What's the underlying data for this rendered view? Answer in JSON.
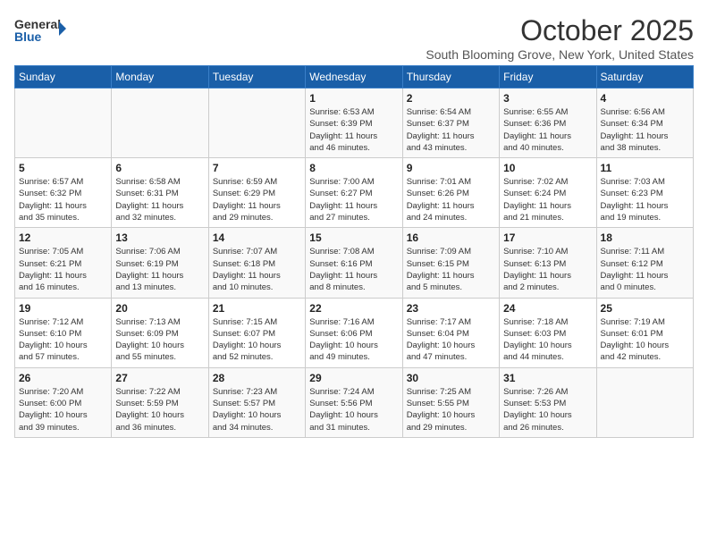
{
  "logo": {
    "line1": "General",
    "line2": "Blue"
  },
  "title": "October 2025",
  "subtitle": "South Blooming Grove, New York, United States",
  "days_of_week": [
    "Sunday",
    "Monday",
    "Tuesday",
    "Wednesday",
    "Thursday",
    "Friday",
    "Saturday"
  ],
  "weeks": [
    [
      {
        "day": "",
        "info": ""
      },
      {
        "day": "",
        "info": ""
      },
      {
        "day": "",
        "info": ""
      },
      {
        "day": "1",
        "info": "Sunrise: 6:53 AM\nSunset: 6:39 PM\nDaylight: 11 hours\nand 46 minutes."
      },
      {
        "day": "2",
        "info": "Sunrise: 6:54 AM\nSunset: 6:37 PM\nDaylight: 11 hours\nand 43 minutes."
      },
      {
        "day": "3",
        "info": "Sunrise: 6:55 AM\nSunset: 6:36 PM\nDaylight: 11 hours\nand 40 minutes."
      },
      {
        "day": "4",
        "info": "Sunrise: 6:56 AM\nSunset: 6:34 PM\nDaylight: 11 hours\nand 38 minutes."
      }
    ],
    [
      {
        "day": "5",
        "info": "Sunrise: 6:57 AM\nSunset: 6:32 PM\nDaylight: 11 hours\nand 35 minutes."
      },
      {
        "day": "6",
        "info": "Sunrise: 6:58 AM\nSunset: 6:31 PM\nDaylight: 11 hours\nand 32 minutes."
      },
      {
        "day": "7",
        "info": "Sunrise: 6:59 AM\nSunset: 6:29 PM\nDaylight: 11 hours\nand 29 minutes."
      },
      {
        "day": "8",
        "info": "Sunrise: 7:00 AM\nSunset: 6:27 PM\nDaylight: 11 hours\nand 27 minutes."
      },
      {
        "day": "9",
        "info": "Sunrise: 7:01 AM\nSunset: 6:26 PM\nDaylight: 11 hours\nand 24 minutes."
      },
      {
        "day": "10",
        "info": "Sunrise: 7:02 AM\nSunset: 6:24 PM\nDaylight: 11 hours\nand 21 minutes."
      },
      {
        "day": "11",
        "info": "Sunrise: 7:03 AM\nSunset: 6:23 PM\nDaylight: 11 hours\nand 19 minutes."
      }
    ],
    [
      {
        "day": "12",
        "info": "Sunrise: 7:05 AM\nSunset: 6:21 PM\nDaylight: 11 hours\nand 16 minutes."
      },
      {
        "day": "13",
        "info": "Sunrise: 7:06 AM\nSunset: 6:19 PM\nDaylight: 11 hours\nand 13 minutes."
      },
      {
        "day": "14",
        "info": "Sunrise: 7:07 AM\nSunset: 6:18 PM\nDaylight: 11 hours\nand 10 minutes."
      },
      {
        "day": "15",
        "info": "Sunrise: 7:08 AM\nSunset: 6:16 PM\nDaylight: 11 hours\nand 8 minutes."
      },
      {
        "day": "16",
        "info": "Sunrise: 7:09 AM\nSunset: 6:15 PM\nDaylight: 11 hours\nand 5 minutes."
      },
      {
        "day": "17",
        "info": "Sunrise: 7:10 AM\nSunset: 6:13 PM\nDaylight: 11 hours\nand 2 minutes."
      },
      {
        "day": "18",
        "info": "Sunrise: 7:11 AM\nSunset: 6:12 PM\nDaylight: 11 hours\nand 0 minutes."
      }
    ],
    [
      {
        "day": "19",
        "info": "Sunrise: 7:12 AM\nSunset: 6:10 PM\nDaylight: 10 hours\nand 57 minutes."
      },
      {
        "day": "20",
        "info": "Sunrise: 7:13 AM\nSunset: 6:09 PM\nDaylight: 10 hours\nand 55 minutes."
      },
      {
        "day": "21",
        "info": "Sunrise: 7:15 AM\nSunset: 6:07 PM\nDaylight: 10 hours\nand 52 minutes."
      },
      {
        "day": "22",
        "info": "Sunrise: 7:16 AM\nSunset: 6:06 PM\nDaylight: 10 hours\nand 49 minutes."
      },
      {
        "day": "23",
        "info": "Sunrise: 7:17 AM\nSunset: 6:04 PM\nDaylight: 10 hours\nand 47 minutes."
      },
      {
        "day": "24",
        "info": "Sunrise: 7:18 AM\nSunset: 6:03 PM\nDaylight: 10 hours\nand 44 minutes."
      },
      {
        "day": "25",
        "info": "Sunrise: 7:19 AM\nSunset: 6:01 PM\nDaylight: 10 hours\nand 42 minutes."
      }
    ],
    [
      {
        "day": "26",
        "info": "Sunrise: 7:20 AM\nSunset: 6:00 PM\nDaylight: 10 hours\nand 39 minutes."
      },
      {
        "day": "27",
        "info": "Sunrise: 7:22 AM\nSunset: 5:59 PM\nDaylight: 10 hours\nand 36 minutes."
      },
      {
        "day": "28",
        "info": "Sunrise: 7:23 AM\nSunset: 5:57 PM\nDaylight: 10 hours\nand 34 minutes."
      },
      {
        "day": "29",
        "info": "Sunrise: 7:24 AM\nSunset: 5:56 PM\nDaylight: 10 hours\nand 31 minutes."
      },
      {
        "day": "30",
        "info": "Sunrise: 7:25 AM\nSunset: 5:55 PM\nDaylight: 10 hours\nand 29 minutes."
      },
      {
        "day": "31",
        "info": "Sunrise: 7:26 AM\nSunset: 5:53 PM\nDaylight: 10 hours\nand 26 minutes."
      },
      {
        "day": "",
        "info": ""
      }
    ]
  ]
}
